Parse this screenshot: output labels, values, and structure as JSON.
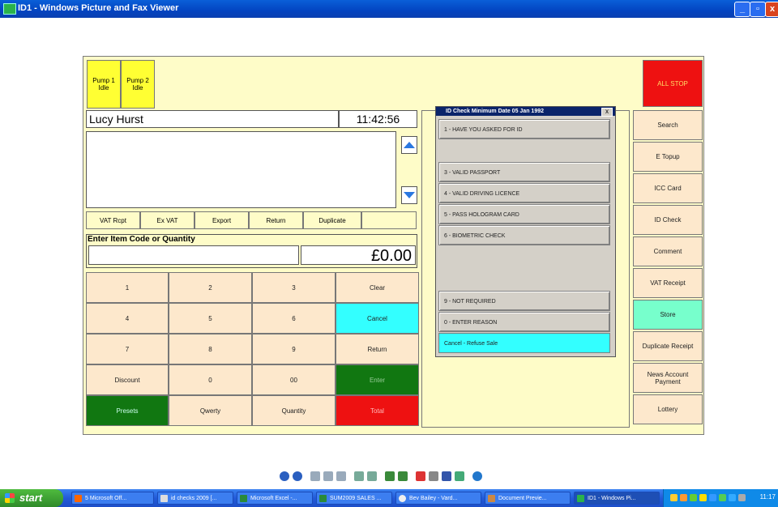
{
  "window": {
    "title": "ID1 - Windows Picture and Fax Viewer"
  },
  "pumps": [
    {
      "label": "Pump 1",
      "status": "Idle"
    },
    {
      "label": "Pump 2",
      "status": "Idle"
    }
  ],
  "all_stop": "ALL STOP",
  "operator": {
    "name": "Lucy Hurst",
    "time": "11:42:56"
  },
  "receipt_tabs": [
    "VAT Rcpt",
    "Ex VAT",
    "Export",
    "Return",
    "Duplicate"
  ],
  "entry": {
    "label": "Enter Item Code or Quantity",
    "amount": "£0.00"
  },
  "keypad": [
    [
      "1",
      "2",
      "3",
      "Clear"
    ],
    [
      "4",
      "5",
      "6",
      "Cancel"
    ],
    [
      "7",
      "8",
      "9",
      "Return"
    ],
    [
      "Discount",
      "0",
      "00",
      "Enter"
    ],
    [
      "Presets",
      "Qwerty",
      "Quantity",
      "Total"
    ]
  ],
  "side_buttons": [
    "Search",
    "E Topup",
    "ICC Card",
    "ID Check",
    "Comment",
    "VAT Receipt",
    "Store",
    "Duplicate Receipt",
    "News Account Payment",
    "Lottery"
  ],
  "dialog": {
    "title": "ID Check Minimum Date 05 Jan 1992",
    "close": "x",
    "options": [
      "1 - HAVE YOU ASKED FOR ID",
      "3 - VALID PASSPORT",
      "4 - VALID DRIVING LICENCE",
      "5 - PASS HOLOGRAM CARD",
      "6 - BIOMETRIC CHECK",
      "9 - NOT REQUIRED",
      "0 - ENTER REASON",
      "Cancel - Refuse Sale"
    ]
  },
  "taskbar": {
    "start": "start",
    "tasks": [
      "5 Microsoft Off...",
      "id checks 2009 [...",
      "Microsoft Excel -...",
      "SUM2009 SALES ...",
      "Bev Bailey - Vard...",
      "Document Previe...",
      "ID1 - Windows Pi..."
    ],
    "clock": "11:17"
  },
  "colors": {
    "yellow": "#ffff33",
    "red": "#ee1111",
    "cyan": "#33ffff",
    "green": "#117711",
    "mint": "#77ffcc",
    "beige": "#fde8cc"
  }
}
